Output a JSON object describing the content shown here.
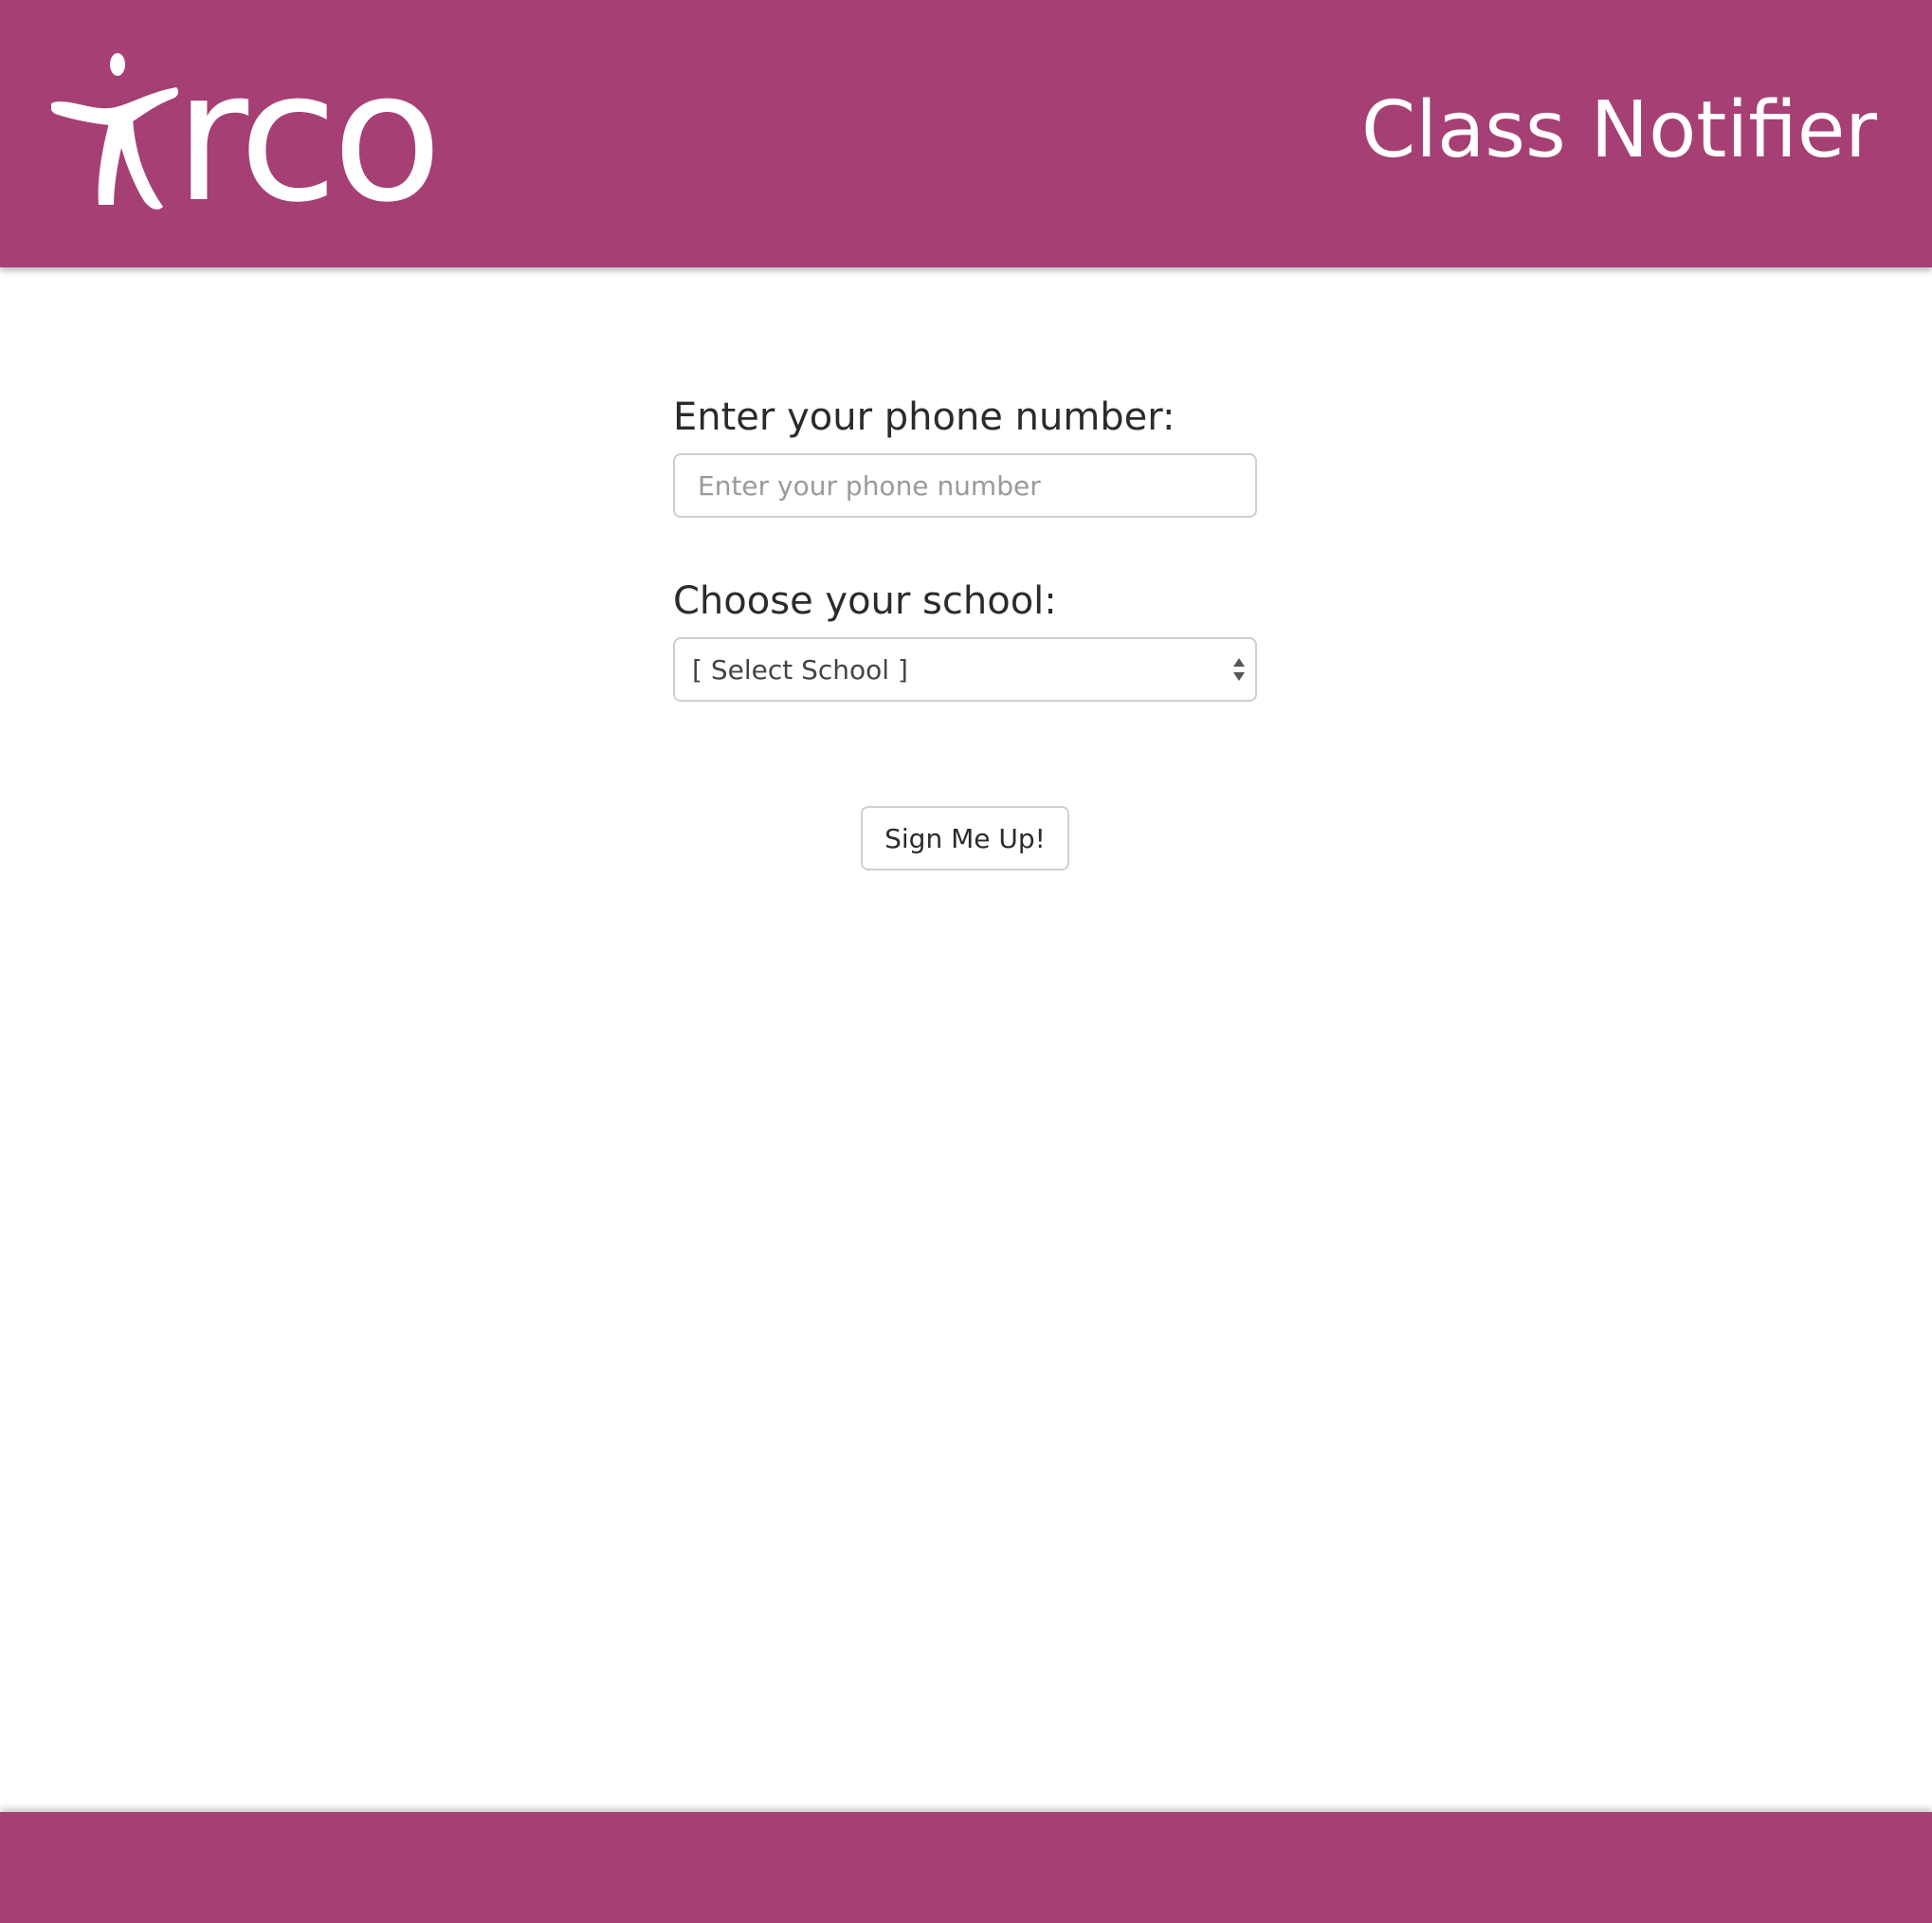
{
  "header": {
    "logo_text": "rco",
    "app_title": "Class Notifier"
  },
  "form": {
    "phone_label": "Enter your phone number:",
    "phone_placeholder": "Enter your phone number",
    "phone_value": "",
    "school_label": "Choose your school:",
    "school_selected": "[ Select School ]",
    "submit_label": "Sign Me Up!"
  },
  "colors": {
    "brand": "#a63f74",
    "background": "#ffffff",
    "text": "#2b2b2b",
    "border": "#cfcfcf"
  },
  "icons": {
    "logo_figure": "person-icon",
    "select_arrows": "up-down-arrows-icon"
  }
}
